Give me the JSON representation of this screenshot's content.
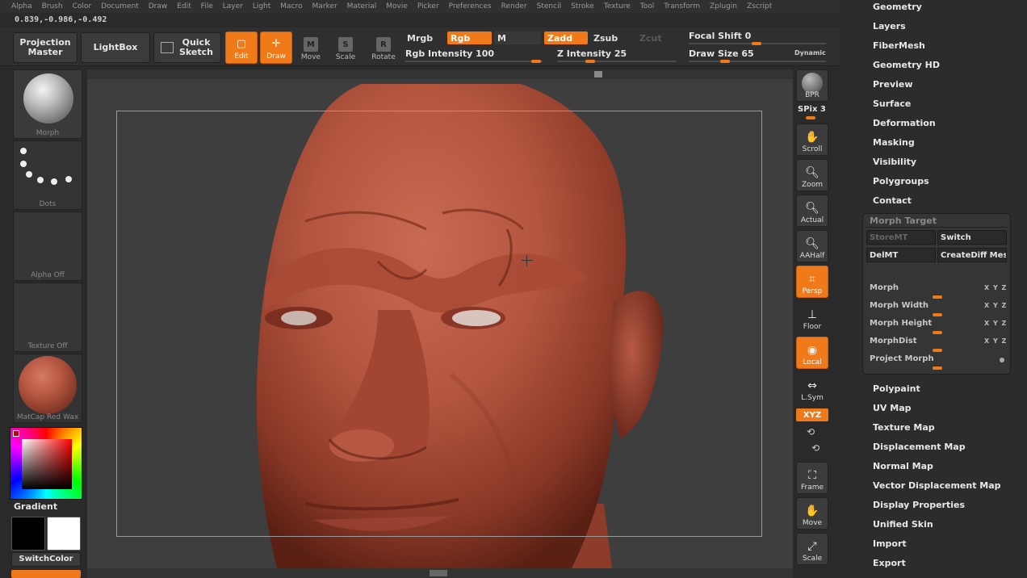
{
  "menu": [
    "Alpha",
    "Brush",
    "Color",
    "Document",
    "Draw",
    "Edit",
    "File",
    "Layer",
    "Light",
    "Macro",
    "Marker",
    "Material",
    "Movie",
    "Picker",
    "Preferences",
    "Render",
    "Stencil",
    "Stroke",
    "Texture",
    "Tool",
    "Transform",
    "Zplugin",
    "Zscript"
  ],
  "coords": "0.839,-0.986,-0.492",
  "shelf": {
    "projection_master": "Projection Master",
    "lightbox": "LightBox",
    "quick_sketch": "Quick Sketch",
    "edit": "Edit",
    "draw": "Draw",
    "move": "Move",
    "scale": "Scale",
    "rotate": "Rotate",
    "mrgb": "Mrgb",
    "rgb": "Rgb",
    "m": "M",
    "zadd": "Zadd",
    "zsub": "Zsub",
    "zcut": "Zcut",
    "rgb_intensity_label": "Rgb Intensity",
    "rgb_intensity": "100",
    "z_intensity_label": "Z Intensity",
    "z_intensity": "25",
    "focal_shift_label": "Focal Shift",
    "focal_shift": "0",
    "draw_size_label": "Draw Size",
    "draw_size": "65",
    "dynamic": "Dynamic"
  },
  "left": {
    "brush": "Morph",
    "stroke": "Dots",
    "alpha": "Alpha Off",
    "texture": "Texture Off",
    "material": "MatCap Red Wax",
    "gradient": "Gradient",
    "switch_color": "SwitchColor"
  },
  "right_shelf": {
    "bpr": "BPR",
    "spix": "SPix 3",
    "scroll": "Scroll",
    "zoom": "Zoom",
    "actual": "Actual",
    "aahalf": "AAHalf",
    "persp": "Persp",
    "floor": "Floor",
    "local": "Local",
    "lsym": "L.Sym",
    "xyz": "XYZ",
    "frame": "Frame",
    "move": "Move",
    "scale": "Scale"
  },
  "panel": {
    "top_items": [
      "Geometry",
      "Layers",
      "FiberMesh",
      "Geometry HD",
      "Preview",
      "Surface",
      "Deformation",
      "Masking",
      "Visibility",
      "Polygroups",
      "Contact"
    ],
    "morph_target": {
      "title": "Morph Target",
      "store": "StoreMT",
      "switch": "Switch",
      "del": "DelMT",
      "create_diff": "CreateDiff Mesh",
      "morph": "Morph",
      "morph_width": "Morph Width",
      "morph_height": "Morph Height",
      "morph_dist": "MorphDist",
      "project_morph": "Project Morph",
      "xyz": "X Y Z"
    },
    "bottom_items": [
      "Polypaint",
      "UV Map",
      "Texture Map",
      "Displacement Map",
      "Normal Map",
      "Vector Displacement Map",
      "Display Properties",
      "Unified Skin",
      "Import",
      "Export"
    ]
  },
  "colors": {
    "accent": "#f07a1a",
    "skin": "#b3553f",
    "bg": "#2c2c2c"
  }
}
